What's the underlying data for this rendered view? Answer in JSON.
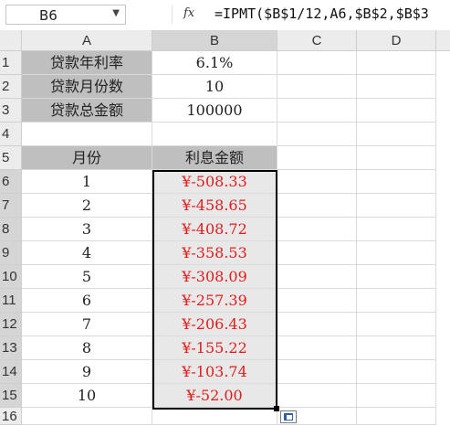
{
  "formula_bar": {
    "name_box": "B6",
    "fx_label": "fx",
    "formula": "=IPMT($B$1/12,A6,$B$2,$B$3"
  },
  "columns": [
    "A",
    "B",
    "C",
    "D"
  ],
  "rows": [
    "1",
    "2",
    "3",
    "4",
    "5",
    "6",
    "7",
    "8",
    "9",
    "10",
    "11",
    "12",
    "13",
    "14",
    "15",
    "16"
  ],
  "loan": {
    "rate_label": "贷款年利率",
    "rate_value": "6.1%",
    "months_label": "贷款月份数",
    "months_value": "10",
    "amount_label": "贷款总金额",
    "amount_value": "100000"
  },
  "table": {
    "col_month": "月份",
    "col_interest": "利息金额",
    "months": [
      "1",
      "2",
      "3",
      "4",
      "5",
      "6",
      "7",
      "8",
      "9",
      "10"
    ],
    "interest": [
      "¥-508.33",
      "¥-458.65",
      "¥-408.72",
      "¥-358.53",
      "¥-308.09",
      "¥-257.39",
      "¥-206.43",
      "¥-155.22",
      "¥-103.74",
      "¥-52.00"
    ]
  },
  "colors": {
    "text_red": "#e31b1b",
    "label_fill": "#bfbfbf",
    "selected_fill": "#e8e8e8"
  }
}
